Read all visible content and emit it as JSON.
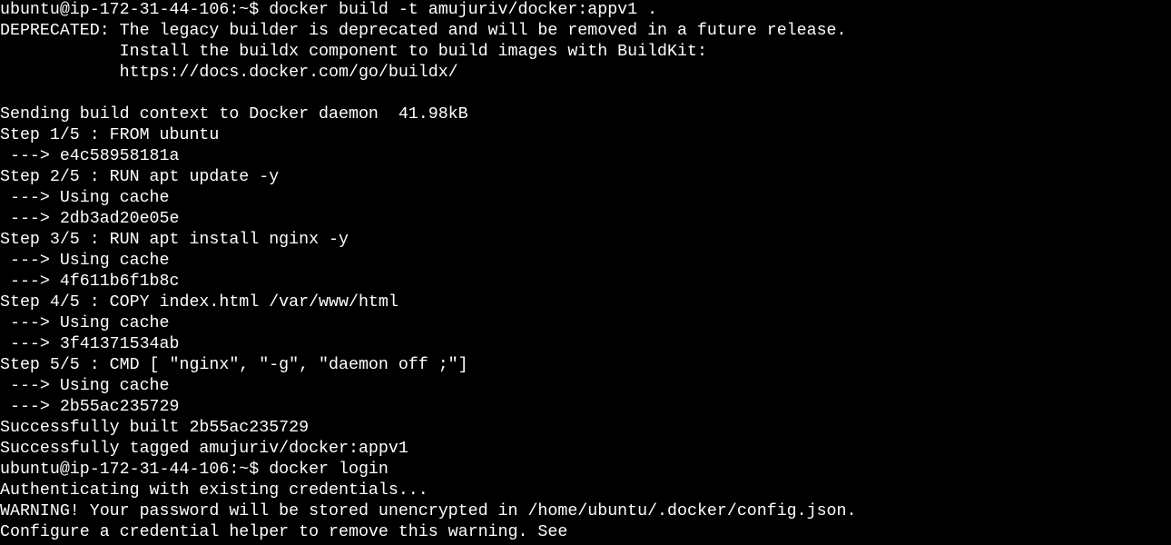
{
  "terminal": {
    "lines": [
      "ubuntu@ip-172-31-44-106:~$ docker build -t amujuriv/docker:appv1 .",
      "DEPRECATED: The legacy builder is deprecated and will be removed in a future release.",
      "            Install the buildx component to build images with BuildKit:",
      "            https://docs.docker.com/go/buildx/",
      "",
      "Sending build context to Docker daemon  41.98kB",
      "Step 1/5 : FROM ubuntu",
      " ---> e4c58958181a",
      "Step 2/5 : RUN apt update -y",
      " ---> Using cache",
      " ---> 2db3ad20e05e",
      "Step 3/5 : RUN apt install nginx -y",
      " ---> Using cache",
      " ---> 4f611b6f1b8c",
      "Step 4/5 : COPY index.html /var/www/html",
      " ---> Using cache",
      " ---> 3f41371534ab",
      "Step 5/5 : CMD [ \"nginx\", \"-g\", \"daemon off ;\"]",
      " ---> Using cache",
      " ---> 2b55ac235729",
      "Successfully built 2b55ac235729",
      "Successfully tagged amujuriv/docker:appv1",
      "ubuntu@ip-172-31-44-106:~$ docker login",
      "Authenticating with existing credentials...",
      "WARNING! Your password will be stored unencrypted in /home/ubuntu/.docker/config.json.",
      "Configure a credential helper to remove this warning. See"
    ]
  }
}
